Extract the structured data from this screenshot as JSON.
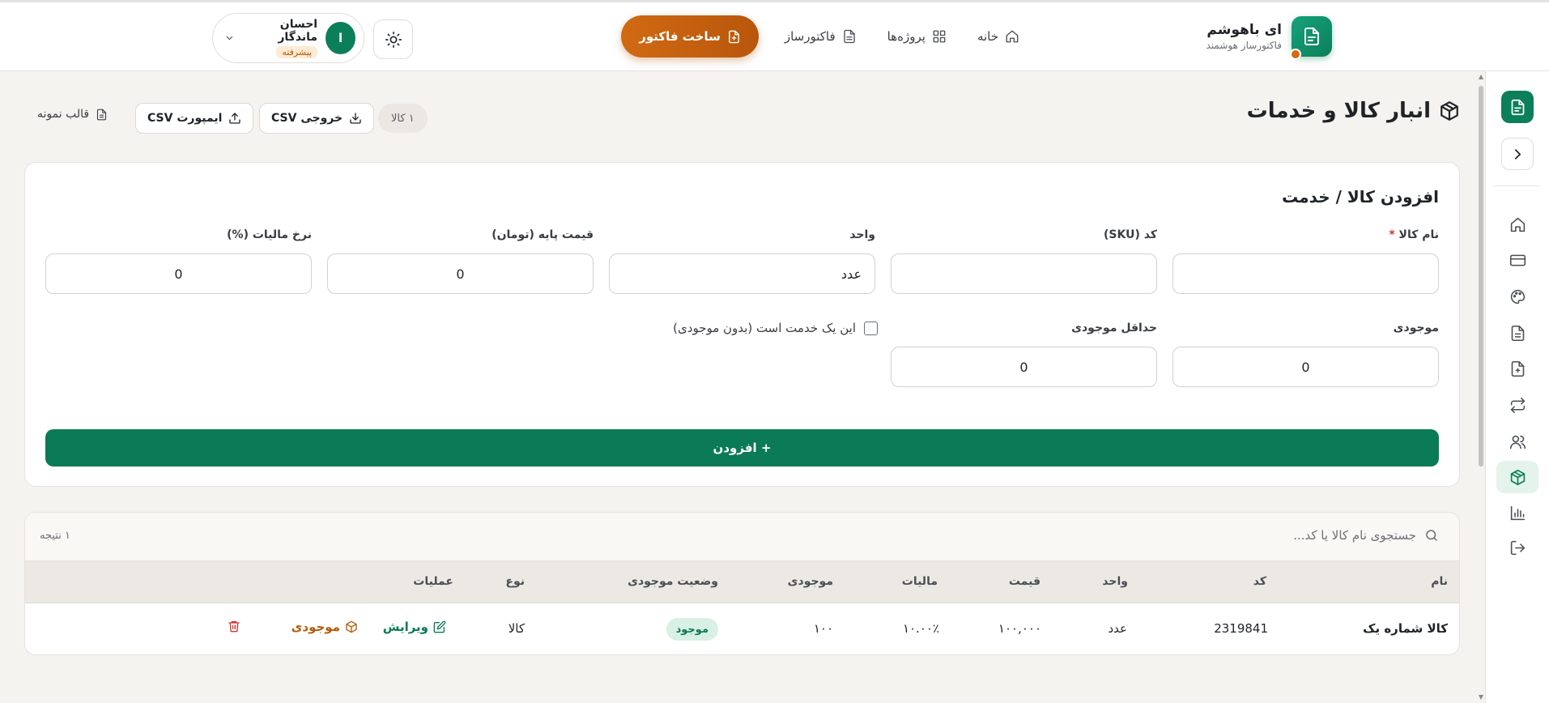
{
  "brand": {
    "name": "ای باهوشم",
    "subtitle": "فاکتورساز هوشمند"
  },
  "nav": {
    "home": "خانه",
    "projects": "پروژه‌ها",
    "invoice_builder": "فاکتورساز",
    "create_invoice": "ساخت فاکتور"
  },
  "user": {
    "name": "احسان ماندگار",
    "initial": "ا",
    "plan": "پیشرفته"
  },
  "page": {
    "title": "انبار کالا و خدمات",
    "count": "۱ کالا",
    "export_csv": "خروجی CSV",
    "import_csv": "ایمپورت CSV",
    "sample_template": "قالب نمونه"
  },
  "form": {
    "title": "افزودن کالا / خدمت",
    "labels": {
      "name": "نام کالا",
      "required_mark": "*",
      "sku": "کد (SKU)",
      "unit": "واحد",
      "base_price": "قیمت پایه (تومان)",
      "tax_rate": "نرخ مالیات (%)",
      "stock": "موجودی",
      "min_stock": "حداقل موجودی"
    },
    "values": {
      "name": "",
      "sku": "",
      "unit": "عدد",
      "base_price": "0",
      "tax_rate": "0",
      "stock": "0",
      "min_stock": "0"
    },
    "service_checkbox": "این یک خدمت است (بدون موجودی)",
    "add_button": "+ افزودن"
  },
  "table": {
    "search_placeholder": "جستجوی نام کالا یا کد...",
    "results": "۱ نتیجه",
    "columns": [
      "نام",
      "کد",
      "واحد",
      "قیمت",
      "مالیات",
      "موجودی",
      "وضعیت موجودی",
      "نوع",
      "عملیات"
    ],
    "rows": [
      {
        "name": "کالا شماره یک",
        "code": "2319841",
        "unit": "عدد",
        "price": "۱۰۰,۰۰۰",
        "tax": "۱۰.۰۰٪",
        "stock": "۱۰۰",
        "status": "موجود",
        "type": "کالا",
        "edit": "ویرایش",
        "inventory": "موجودی"
      }
    ]
  },
  "colors": {
    "primary": "#0b7a56",
    "accent": "#c9620f",
    "background": "#f5f3f0"
  }
}
